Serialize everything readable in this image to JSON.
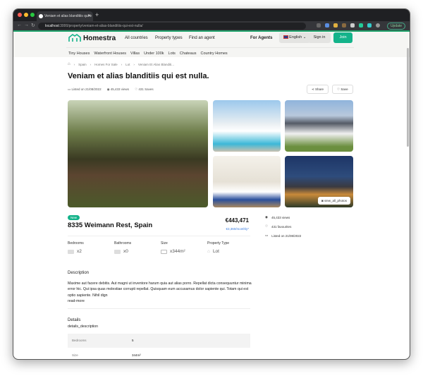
{
  "browser": {
    "tab_title": "Veniam et alias blanditiis qui e",
    "url_host": "localhost",
    "url_path": ":3000/property/veniam-et-alias-blanditiis-qui-est-nulla/",
    "update_label": "Update"
  },
  "header": {
    "brand": "Homestra",
    "nav": [
      "All countries",
      "Property types",
      "Find an agent"
    ],
    "for_agents": "For Agents",
    "language": "English",
    "sign_in": "Sign in",
    "join": "Join",
    "accent": "#14b38a"
  },
  "subnav": [
    "Tiny Houses",
    "Waterfront Houses",
    "Villas",
    "Under 100k",
    "Lots",
    "Chateaus",
    "Country Homes"
  ],
  "breadcrumb": [
    "Spain",
    "Homes For Sale",
    "Lot",
    "Veniam Et Alias Blanditi..."
  ],
  "listing": {
    "title": "Veniam et alias blanditiis qui est nulla.",
    "listed": "Listed on 21/08/2022",
    "views": "45,433 views",
    "saves": "431 Saves",
    "share": "Share",
    "save": "Save",
    "view_all_photos": "view_all_photos",
    "badge": "New",
    "address": "8335 Weimann Rest, Spain",
    "price": "€443,471",
    "monthly": "€3,360/monthly*",
    "side": {
      "views": "45,433 views",
      "favourites": "431 favourites",
      "listed": "Listed on 21/08/2022"
    },
    "features": [
      {
        "label": "Bedrooms",
        "value": "x2"
      },
      {
        "label": "Bathrooms",
        "value": "x0"
      },
      {
        "label": "Size",
        "value": "x344m²"
      },
      {
        "label": "Property Type",
        "value": "Lot"
      }
    ],
    "description_heading": "Description",
    "description": "Maxime aut facere debitis. Aut magni ut inventore harum quia aut alias porro. Repellat dicta consequuntur minima error hic. Qui ipsa quas molestiae corrupti repellat. Quisquam eum accusamus dolor sapiente qui. Totam qui est optio sapiente. Nihil dign",
    "read_more": "read-more",
    "details_heading": "Details",
    "details_description": "details_description",
    "details_rows": [
      {
        "label": "Bedrooms",
        "value": "5"
      },
      {
        "label": "Size",
        "value": "344m²"
      }
    ]
  }
}
